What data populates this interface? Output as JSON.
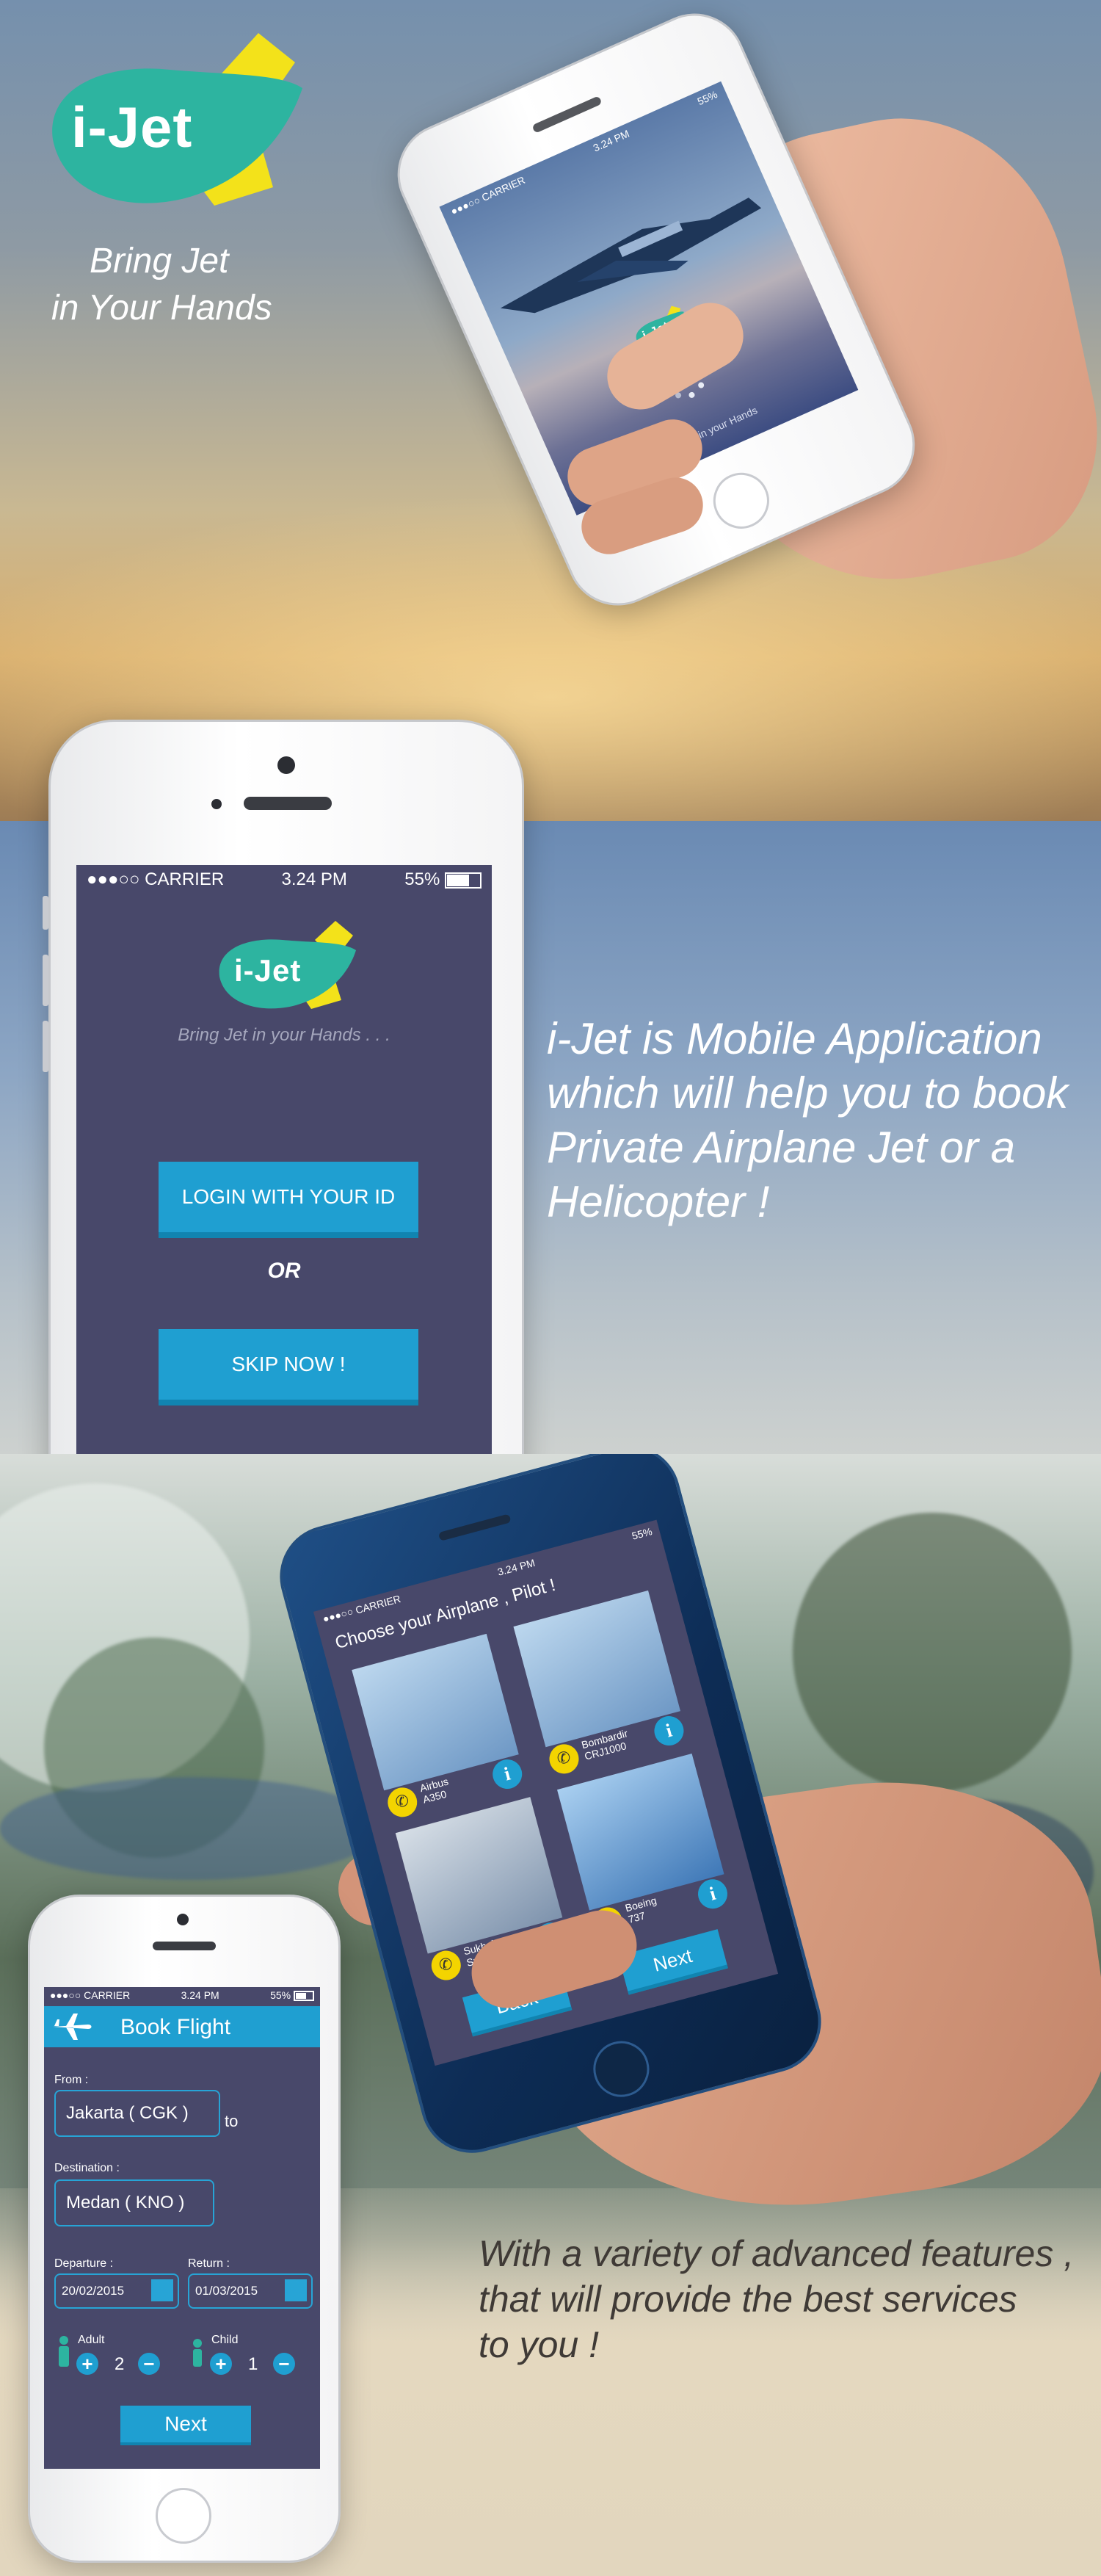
{
  "colors": {
    "teal": "#2db4a0",
    "yellow": "#f3e21a",
    "screen": "#48486a",
    "accent_blue": "#1f9fd1"
  },
  "brand": {
    "logo_text": "i-Jet",
    "tagline_line1": "Bring Jet",
    "tagline_line2": "in Your Hands"
  },
  "splash_phone": {
    "carrier": "●●●○○ CARRIER",
    "time": "3.24 PM",
    "battery": "55%",
    "logo_text": "i-Jet",
    "caption": "Bring Jet in your Hands"
  },
  "login_phone": {
    "carrier": "●●●○○ CARRIER",
    "time": "3.24 PM",
    "battery": "55%",
    "logo_text": "i-Jet",
    "tagline": "Bring Jet in your Hands . . .",
    "login_button": "LOGIN WITH YOUR ID",
    "or_text": "OR",
    "skip_button": "SKIP NOW !"
  },
  "description": {
    "line1": "i-Jet is Mobile Application",
    "line2": "which will help you to book",
    "line3": "Private Airplane Jet or a",
    "line4": "Helicopter !"
  },
  "choose_phone": {
    "carrier": "●●●○○ CARRIER",
    "time": "3.24 PM",
    "battery": "55%",
    "title": "Choose your Airplane , Pilot !",
    "planes": [
      {
        "name1": "Airbus",
        "name2": "A350"
      },
      {
        "name1": "Bombardir",
        "name2": "CRJ1000"
      },
      {
        "name1": "Sukhoi",
        "name2": "Superjet 100"
      },
      {
        "name1": "Boeing",
        "name2": "737"
      }
    ],
    "back_button": "Back",
    "next_button": "Next"
  },
  "book_phone": {
    "carrier": "●●●○○ CARRIER",
    "time": "3.24 PM",
    "battery": "55%",
    "header_title": "Book Flight",
    "from_label": "From :",
    "from_value": "Jakarta ( CGK )",
    "to_text": "to",
    "destination_label": "Destination :",
    "destination_value": "Medan ( KNO )",
    "departure_label": "Departure :",
    "departure_value": "20/02/2015",
    "return_label": "Return :",
    "return_value": "01/03/2015",
    "adult_label": "Adult",
    "adult_count": "2",
    "child_label": "Child",
    "child_count": "1",
    "plus": "+",
    "minus": "−",
    "next_button": "Next"
  },
  "features": {
    "line1": "With a variety of advanced features ,",
    "line2": "that will provide the best services",
    "line3": "to you !"
  }
}
